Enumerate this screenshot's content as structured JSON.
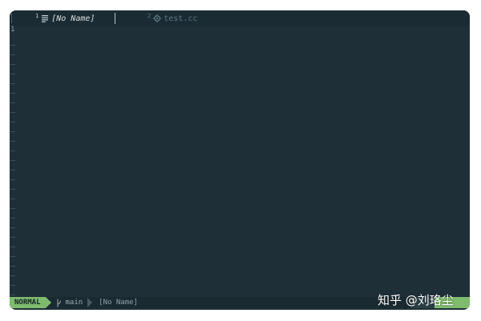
{
  "tabline": {
    "tabs": [
      {
        "number": "1",
        "label": "[No Name]",
        "icon": "lines-icon",
        "active": true
      },
      {
        "number": "2",
        "label": "test.cc",
        "icon": "gear-icon",
        "active": false
      }
    ]
  },
  "editor": {
    "line_numbers": [
      "1"
    ],
    "empty_line_marker": "~"
  },
  "statusline": {
    "mode": "NORMAL",
    "branch": "main",
    "branch_icon": "git-branch-icon",
    "filename": "[No Name]"
  },
  "watermark": {
    "text": "知乎 @刘珞尘"
  },
  "colors": {
    "background": "#1e2f38",
    "tabline": "#1a2b33",
    "mode_accent": "#7fbb6d",
    "statusline": "#1a2a31"
  }
}
